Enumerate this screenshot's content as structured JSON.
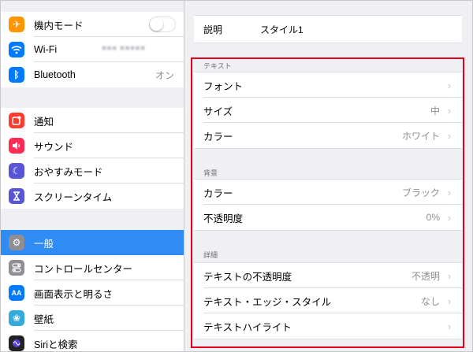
{
  "sidebar": {
    "group1": [
      {
        "label": "機内モード",
        "icon": "airplane-icon",
        "icon_color": "#ff9500",
        "glyph": "✈",
        "control": "toggle",
        "toggle_on": false
      },
      {
        "label": "Wi-Fi",
        "icon": "wifi-icon",
        "icon_color": "#007aff",
        "glyph": "≋",
        "value": ""
      },
      {
        "label": "Bluetooth",
        "icon": "bluetooth-icon",
        "icon_color": "#007aff",
        "glyph": "ᛒ",
        "value": "オン"
      }
    ],
    "group2": [
      {
        "label": "通知",
        "icon": "notifications-icon",
        "icon_color": "#ff3b30",
        "glyph": "▣"
      },
      {
        "label": "サウンド",
        "icon": "sound-icon",
        "icon_color": "#ff2d55",
        "glyph": "◀"
      },
      {
        "label": "おやすみモード",
        "icon": "moon-icon",
        "icon_color": "#5856d6",
        "glyph": "☾"
      },
      {
        "label": "スクリーンタイム",
        "icon": "hourglass-icon",
        "icon_color": "#5856d6",
        "glyph": "⧗"
      }
    ],
    "group3": [
      {
        "label": "一般",
        "icon": "gear-icon",
        "icon_color": "#8e8e93",
        "glyph": "⚙",
        "selected": true
      },
      {
        "label": "コントロールセンター",
        "icon": "control-center-icon",
        "icon_color": "#8e8e93",
        "glyph": "◐"
      },
      {
        "label": "画面表示と明るさ",
        "icon": "display-brightness-icon",
        "icon_color": "#007aff",
        "glyph": "AA"
      },
      {
        "label": "壁紙",
        "icon": "wallpaper-icon",
        "icon_color": "#34aadc",
        "glyph": "❀"
      },
      {
        "label": "Siriと検索",
        "icon": "siri-icon",
        "icon_color": "#222222",
        "glyph": "◉"
      }
    ]
  },
  "detail": {
    "description": {
      "label": "説明",
      "value": "スタイル1"
    },
    "sections": [
      {
        "header": "テキスト",
        "rows": [
          {
            "label": "フォント",
            "value": ""
          },
          {
            "label": "サイズ",
            "value": "中"
          },
          {
            "label": "カラー",
            "value": "ホワイト"
          }
        ]
      },
      {
        "header": "背景",
        "rows": [
          {
            "label": "カラー",
            "value": "ブラック"
          },
          {
            "label": "不透明度",
            "value": "0%"
          }
        ]
      },
      {
        "header": "詳細",
        "rows": [
          {
            "label": "テキストの不透明度",
            "value": "不透明"
          },
          {
            "label": "テキスト・エッジ・スタイル",
            "value": "なし"
          },
          {
            "label": "テキストハイライト",
            "value": ""
          }
        ]
      }
    ]
  },
  "colors": {
    "selection": "#2f8cf5",
    "highlight_box": "#e0001b"
  }
}
